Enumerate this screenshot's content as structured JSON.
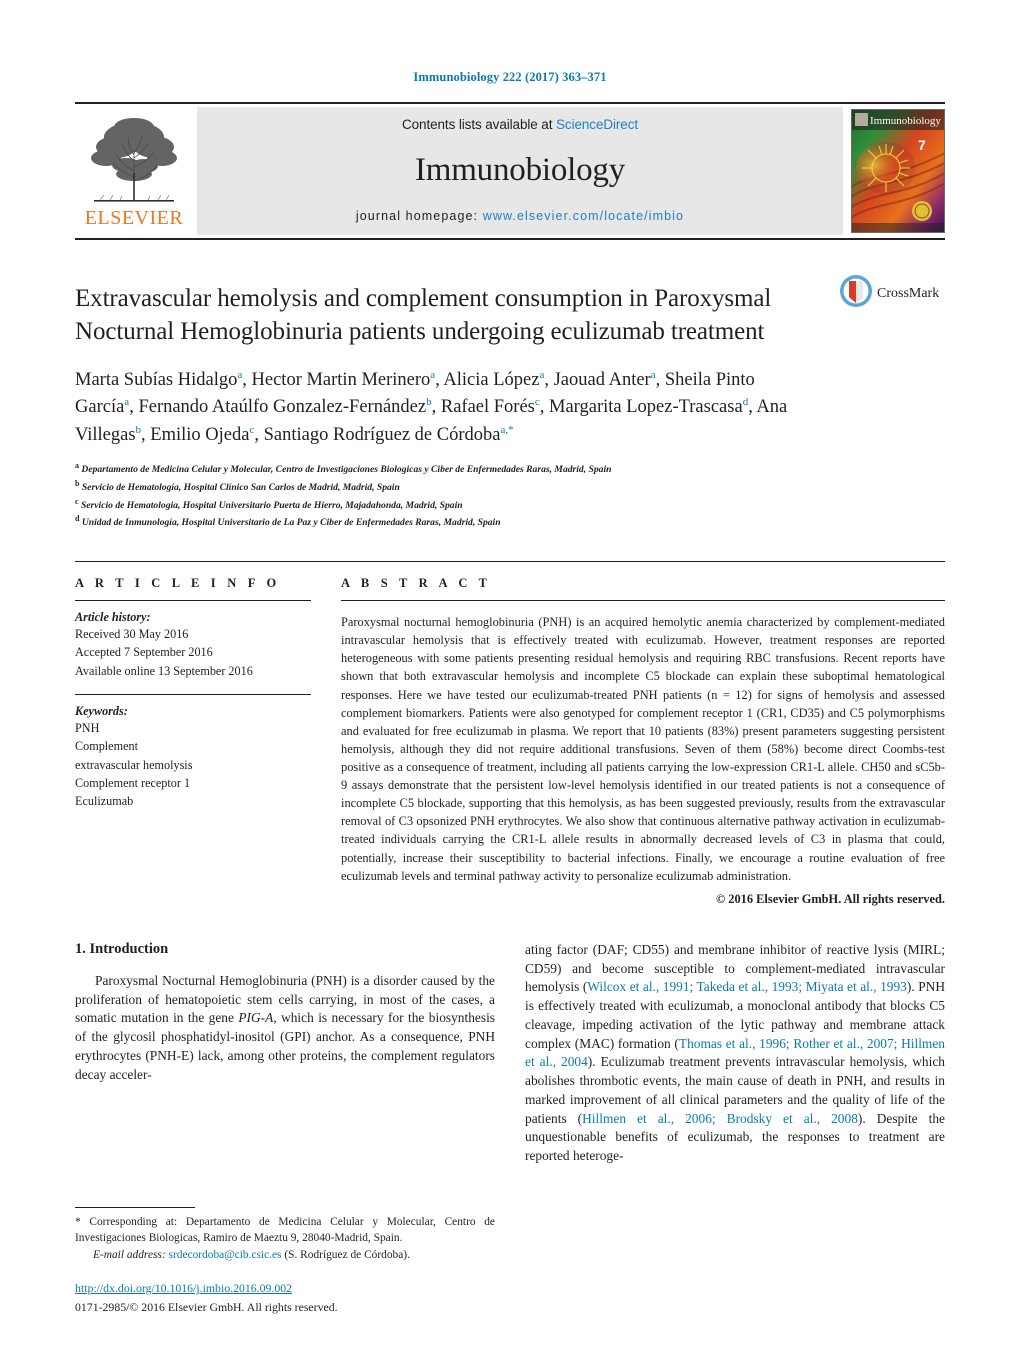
{
  "running_head": "Immunobiology 222 (2017) 363–371",
  "masthead": {
    "publisher_name": "ELSEVIER",
    "contents_prefix": "Contents lists available at ",
    "contents_link": "ScienceDirect",
    "journal_name": "Immunobiology",
    "homepage_prefix": "journal homepage: ",
    "homepage_url": "www.elsevier.com/locate/imbio",
    "cover_title": "Immunobiology",
    "cover_issue": "7"
  },
  "crossmark": {
    "label": "CrossMark"
  },
  "article": {
    "title": "Extravascular hemolysis and complement consumption in Paroxysmal Nocturnal Hemoglobinuria patients undergoing eculizumab treatment",
    "authors_html": "Marta Subías Hidalgo<sup>a</sup>, Hector Martin Merinero<sup>a</sup>, Alicia López<sup>a</sup>, Jaouad Anter<sup>a</sup>, Sheila Pinto García<sup>a</sup>, Fernando Ataúlfo Gonzalez-Fernández<sup>b</sup>, Rafael Forés<sup>c</sup>, Margarita Lopez-Trascasa<sup>d</sup>, Ana Villegas<sup>b</sup>, Emilio Ojeda<sup>c</sup>, Santiago Rodríguez de Córdoba<sup>a,<span class=\"star\">*</span></sup>",
    "affiliations": [
      {
        "marker": "a",
        "text": "Departamento de Medicina Celular y Molecular, Centro de Investigaciones Biologicas y Ciber de Enfermedades Raras, Madrid, Spain"
      },
      {
        "marker": "b",
        "text": "Servicio de Hematología, Hospital Clínico San Carlos de Madrid, Madrid, Spain"
      },
      {
        "marker": "c",
        "text": "Servicio de Hematologia, Hospital Universitario Puerta de Hierro, Majadahonda, Madrid, Spain"
      },
      {
        "marker": "d",
        "text": "Unidad de Inmunología, Hospital Universitario de La Paz y Ciber de Enfermedades Raras, Madrid, Spain"
      }
    ]
  },
  "article_info": {
    "heading": "A R T I C L E   I N F O",
    "history_label": "Article history:",
    "history_lines": [
      "Received 30 May 2016",
      "Accepted 7 September 2016",
      "Available online 13 September 2016"
    ],
    "keywords_label": "Keywords:",
    "keywords": [
      "PNH",
      "Complement",
      "extravascular hemolysis",
      "Complement receptor 1",
      "Eculizumab"
    ]
  },
  "abstract": {
    "heading": "A B S T R A C T",
    "paragraph": "Paroxysmal nocturnal hemoglobinuria (PNH) is an acquired hemolytic anemia characterized by complement-mediated intravascular hemolysis that is effectively treated with eculizumab. However, treatment responses are reported heterogeneous with some patients presenting residual hemolysis and requiring RBC transfusions. Recent reports have shown that both extravascular hemolysis and incomplete C5 blockade can explain these suboptimal hematological responses. Here we have tested our eculizumab-treated PNH patients (n = 12) for signs of hemolysis and assessed complement biomarkers. Patients were also genotyped for complement receptor 1 (CR1, CD35) and C5 polymorphisms and evaluated for free eculizumab in plasma. We report that 10 patients (83%) present parameters suggesting persistent hemolysis, although they did not require additional transfusions. Seven of them (58%) become direct Coombs-test positive as a consequence of treatment, including all patients carrying the low-expression CR1-L allele. CH50 and sC5b-9 assays demonstrate that the persistent low-level hemolysis identified in our treated patients is not a consequence of incomplete C5 blockade, supporting that this hemolysis, as has been suggested previously, results from the extravascular removal of C3 opsonized PNH erythrocytes. We also show that continuous alternative pathway activation in eculizumab-treated individuals carrying the CR1-L allele results in abnormally decreased levels of C3 in plasma that could, potentially, increase their susceptibility to bacterial infections. Finally, we encourage a routine evaluation of free eculizumab levels and terminal pathway activity to personalize eculizumab administration.",
    "copyright": "© 2016 Elsevier GmbH. All rights reserved."
  },
  "introduction": {
    "heading": "1.  Introduction",
    "left_paragraph_html": "Paroxysmal Nocturnal Hemoglobinuria (PNH) is a disorder caused by the proliferation of hematopoietic stem cells carrying, in most of the cases, a somatic mutation in the gene <i>PIG-A</i>, which is necessary for the biosynthesis of the glycosil phosphatidyl-inositol (GPI) anchor. As a consequence, PNH erythrocytes (PNH-E) lack, among other proteins, the complement regulators decay acceler-",
    "right_paragraph_html": "ating factor (DAF; CD55) and membrane inhibitor of reactive lysis (MIRL; CD59) and become susceptible to complement-mediated intravascular hemolysis (<span class=\"cite\">Wilcox et al., 1991; Takeda et al., 1993; Miyata et al., 1993</span>). PNH is effectively treated with eculizumab, a monoclonal antibody that blocks C5 cleavage, impeding activation of the lytic pathway and membrane attack complex (MAC) formation (<span class=\"cite\">Thomas et al., 1996; Rother et al., 2007; Hillmen et al., 2004</span>). Eculizumab treatment prevents intravascular hemolysis, which abolishes thrombotic events, the main cause of death in PNH, and results in marked improvement of all clinical parameters and the quality of life of the patients (<span class=\"cite\">Hillmen et al., 2006; Brodsky et al., 2008</span>). Despite the unquestionable benefits of eculizumab, the responses to treatment are reported heteroge-"
  },
  "footnote": {
    "corresponding_html": "<span class=\"star\">*</span> Corresponding at: Departamento de Medicina Celular y Molecular, Centro de Investigaciones Biologicas, Ramiro de Maeztu 9, 28040-Madrid, Spain.",
    "email_html": "<span class=\"email-label\">E-mail address:</span> <span class=\"email-link\">srdecordoba@cib.csic.es</span> (S. Rodríguez de Córdoba)."
  },
  "footer": {
    "doi": "http://dx.doi.org/10.1016/j.imbio.2016.09.002",
    "issn_line": "0171-2985/© 2016 Elsevier GmbH. All rights reserved."
  },
  "colors": {
    "link": "#0b7bad",
    "sciencedirect": "#1f7fc4",
    "elsevier_orange": "#ef7622",
    "masthead_bg": "#e7e7e8"
  }
}
